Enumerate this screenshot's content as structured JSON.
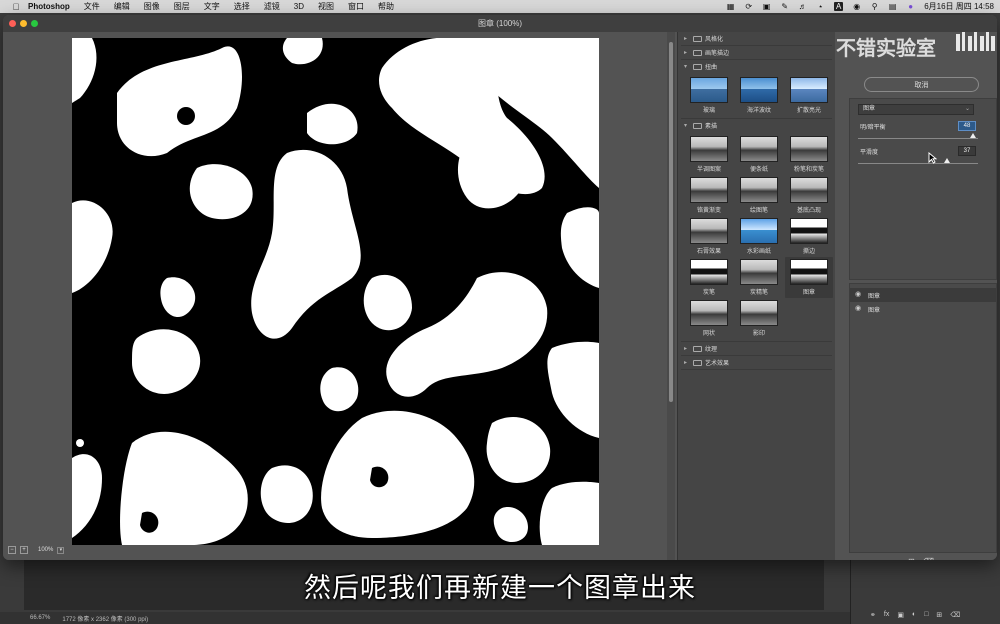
{
  "menubar": {
    "app_name": "Photoshop",
    "menus": [
      "文件",
      "编辑",
      "图像",
      "图层",
      "文字",
      "选择",
      "滤镜",
      "3D",
      "视图",
      "窗口",
      "帮助"
    ],
    "datetime": "6月16日 周四  14:58",
    "status_icons": [
      "layout-icon",
      "sync-icon",
      "screen-icon",
      "notes-icon",
      "volume-icon",
      "bluetooth-icon",
      "font-icon",
      "wifi-icon",
      "search-icon",
      "control-center-icon",
      "siri-icon"
    ]
  },
  "dialog": {
    "title": "图章 (100%)",
    "zoom": "100%"
  },
  "gallery": {
    "folders": [
      {
        "label": "风格化",
        "expanded": false
      },
      {
        "label": "画笔描边",
        "expanded": false
      },
      {
        "label": "扭曲",
        "expanded": true,
        "items": [
          "玻璃",
          "海洋波纹",
          "扩散亮光"
        ]
      },
      {
        "label": "素描",
        "expanded": true,
        "items": [
          "半调图案",
          "便条纸",
          "粉笔和炭笔",
          "铬黄渐变",
          "绘图笔",
          "基底凸现",
          "石膏效果",
          "水彩画纸",
          "撕边",
          "炭笔",
          "炭精笔",
          "图章",
          "网状",
          "影印"
        ]
      },
      {
        "label": "纹理",
        "expanded": false
      },
      {
        "label": "艺术效果",
        "expanded": false
      }
    ],
    "selected": "图章"
  },
  "settings": {
    "cancel_label": "取消",
    "filter_name": "图章",
    "param1_label": "明/暗平衡",
    "param1_value": "48",
    "param1_level": 0.96,
    "param2_label": "平滑度",
    "param2_value": "37",
    "param2_level": 0.74
  },
  "layers": [
    {
      "name": "图章",
      "active": true
    },
    {
      "name": "图章",
      "active": false
    }
  ],
  "statusbar": {
    "zoom": "66.67%",
    "doc_info": "1772 像素 x 2362 像素 (300 ppi)"
  },
  "overlay": {
    "subtitle": "然后呢我们再新建一个图章出来",
    "watermark": "不错实验室"
  }
}
